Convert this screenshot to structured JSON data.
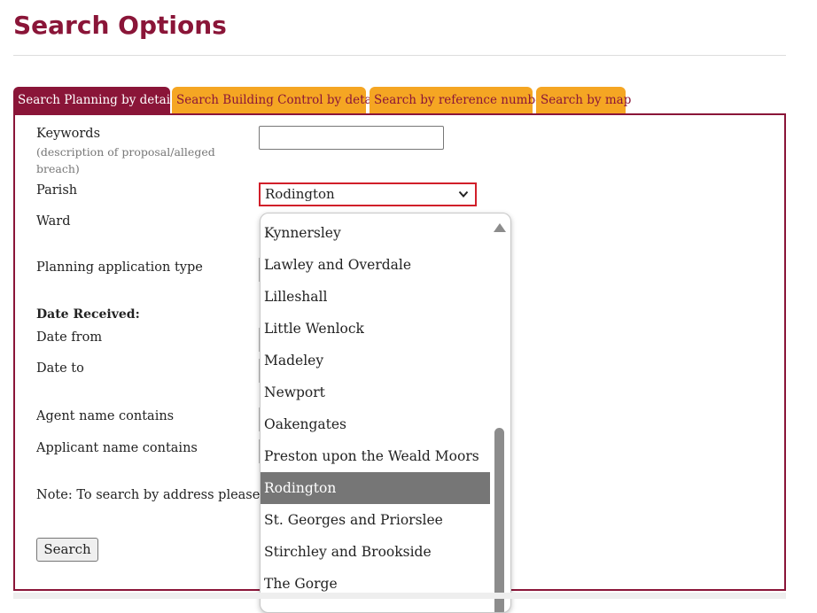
{
  "page": {
    "title": "Search Options"
  },
  "tabs": [
    {
      "label": "Search Planning by details",
      "active": true
    },
    {
      "label": "Search Building Control by details",
      "active": false
    },
    {
      "label": "Search by reference number",
      "active": false
    },
    {
      "label": "Search by map",
      "active": false
    }
  ],
  "form": {
    "keywords_label": "Keywords",
    "keywords_hint": "(description of proposal/alleged breach)",
    "keywords_value": "",
    "parish_label": "Parish",
    "parish_value": "Rodington",
    "ward_label": "Ward",
    "app_type_label": "Planning application type",
    "date_received_label": "Date Received:",
    "date_from_label": "Date from",
    "date_to_label": "Date to",
    "agent_label": "Agent name contains",
    "applicant_label": "Applicant name contains",
    "note_text": "Note: To search by address please use",
    "search_button": "Search"
  },
  "parish_dropdown": {
    "options": [
      "Kynnersley",
      "Lawley and Overdale",
      "Lilleshall",
      "Little Wenlock",
      "Madeley",
      "Newport",
      "Oakengates",
      "Preston upon the Weald Moors",
      "Rodington",
      "St. Georges and Priorslee",
      "Stirchley and Brookside",
      "The Gorge"
    ],
    "selected": "Rodington",
    "scroll_position": 0.8
  },
  "colors": {
    "brand": "#8a1538",
    "tab_inactive": "#f5a623",
    "focus_border": "#d11f2a",
    "selected_option": "#767676"
  },
  "icons": {
    "select_arrow": "chevron-down-icon",
    "scroll_up": "scroll-up-arrow-icon"
  }
}
